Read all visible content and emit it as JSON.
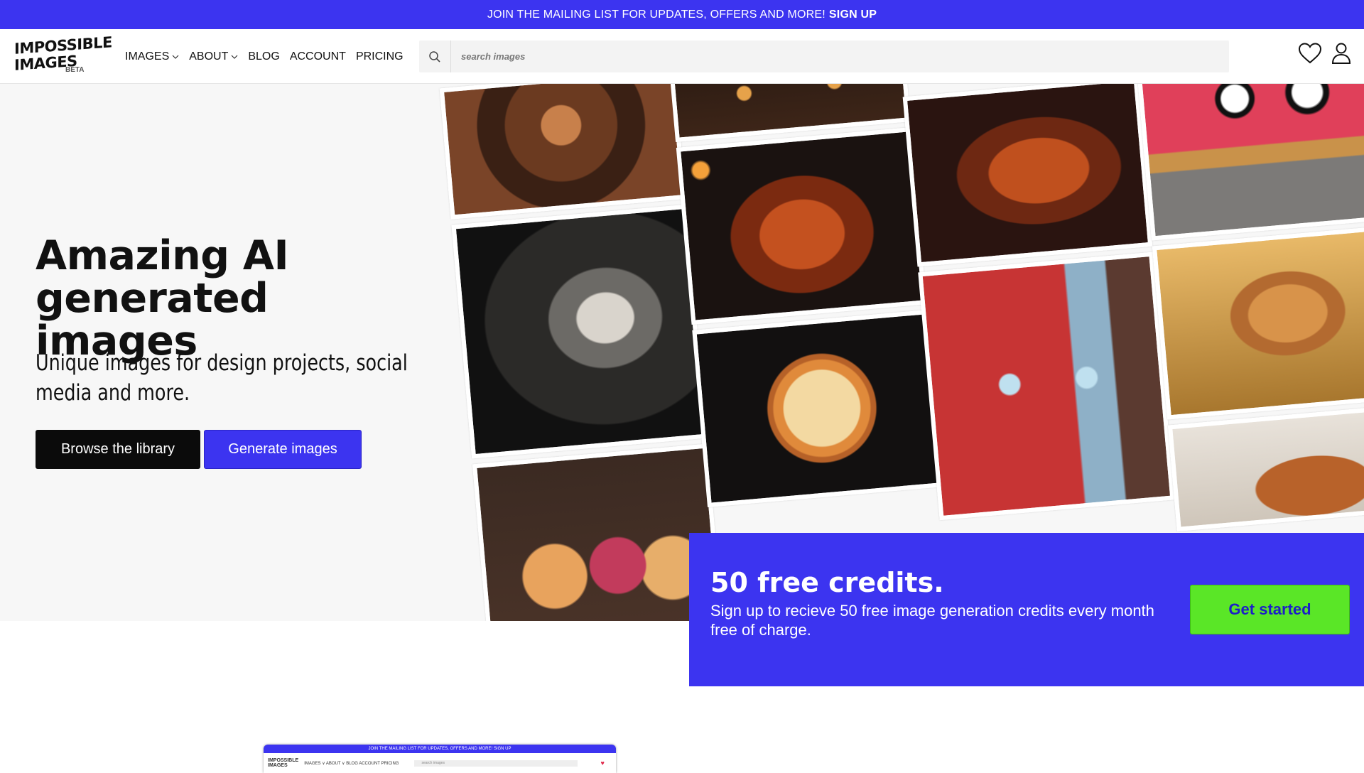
{
  "announcement": {
    "text": "JOIN THE MAILING LIST FOR UPDATES, OFFERS AND MORE!",
    "link": "SIGN UP"
  },
  "logo": {
    "line1": "IMPOSSIBLE",
    "line2": "IMAGES",
    "badge": "BETA"
  },
  "nav": {
    "images": "IMAGES",
    "about": "ABOUT",
    "blog": "BLOG",
    "account": "ACCOUNT",
    "pricing": "PRICING"
  },
  "search": {
    "placeholder": "search images"
  },
  "hero": {
    "title": "Amazing AI generated images",
    "subtitle": "Unique images for design projects, social media and more.",
    "browse_label": "Browse the library",
    "generate_label": "Generate images"
  },
  "promo": {
    "title": "50 free credits.",
    "text": "Sign up to recieve 50 free image generation credits every month free of charge.",
    "button": "Get started"
  },
  "preview": {
    "bar_text": "JOIN THE MAILING LIST FOR UPDATES, OFFERS AND MORE! SIGN UP",
    "nav_text": "IMAGES ∨  ABOUT ∨  BLOG  ACCOUNT  PRICING",
    "search_placeholder": "search images"
  },
  "colors": {
    "brand_blue": "#3c34f0",
    "cta_green": "#5ae627",
    "dark_button": "#0b0b0b"
  }
}
